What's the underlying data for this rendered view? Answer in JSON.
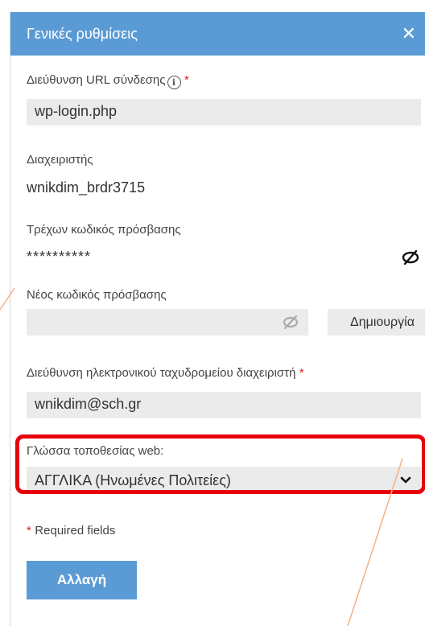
{
  "header": {
    "title": "Γενικές ρυθμίσεις",
    "close_glyph": "✕"
  },
  "login_url": {
    "label": "Διεύθυνση URL σύνδεσης",
    "info_glyph": "i",
    "required_mark": "*",
    "value": "wp-login.php"
  },
  "admin": {
    "label": "Διαχειριστής",
    "value": "wnikdim_brdr3715"
  },
  "current_password": {
    "label": "Τρέχων κωδικός πρόσβασης",
    "value": "**********"
  },
  "new_password": {
    "label": "Νέος κωδικός πρόσβασης",
    "value": "",
    "generate_label": "Δημιουργία"
  },
  "admin_email": {
    "label": "Διεύθυνση ηλεκτρονικού ταχυδρομείου διαχειριστή",
    "required_mark": "*",
    "value": "wnikdim@sch.gr"
  },
  "site_language": {
    "label": "Γλώσσα τοποθεσίας web:",
    "selected": "ΑΓΓΛΙΚΑ (Ηνωμένες Πολιτείες)"
  },
  "footer": {
    "required_mark": "*",
    "required_note": "Required fields",
    "submit_label": "Αλλαγή"
  },
  "colors": {
    "accent": "#5b9bd5",
    "required": "#d9211a",
    "highlight": "#e8000b",
    "annotation": "#f4b183"
  }
}
